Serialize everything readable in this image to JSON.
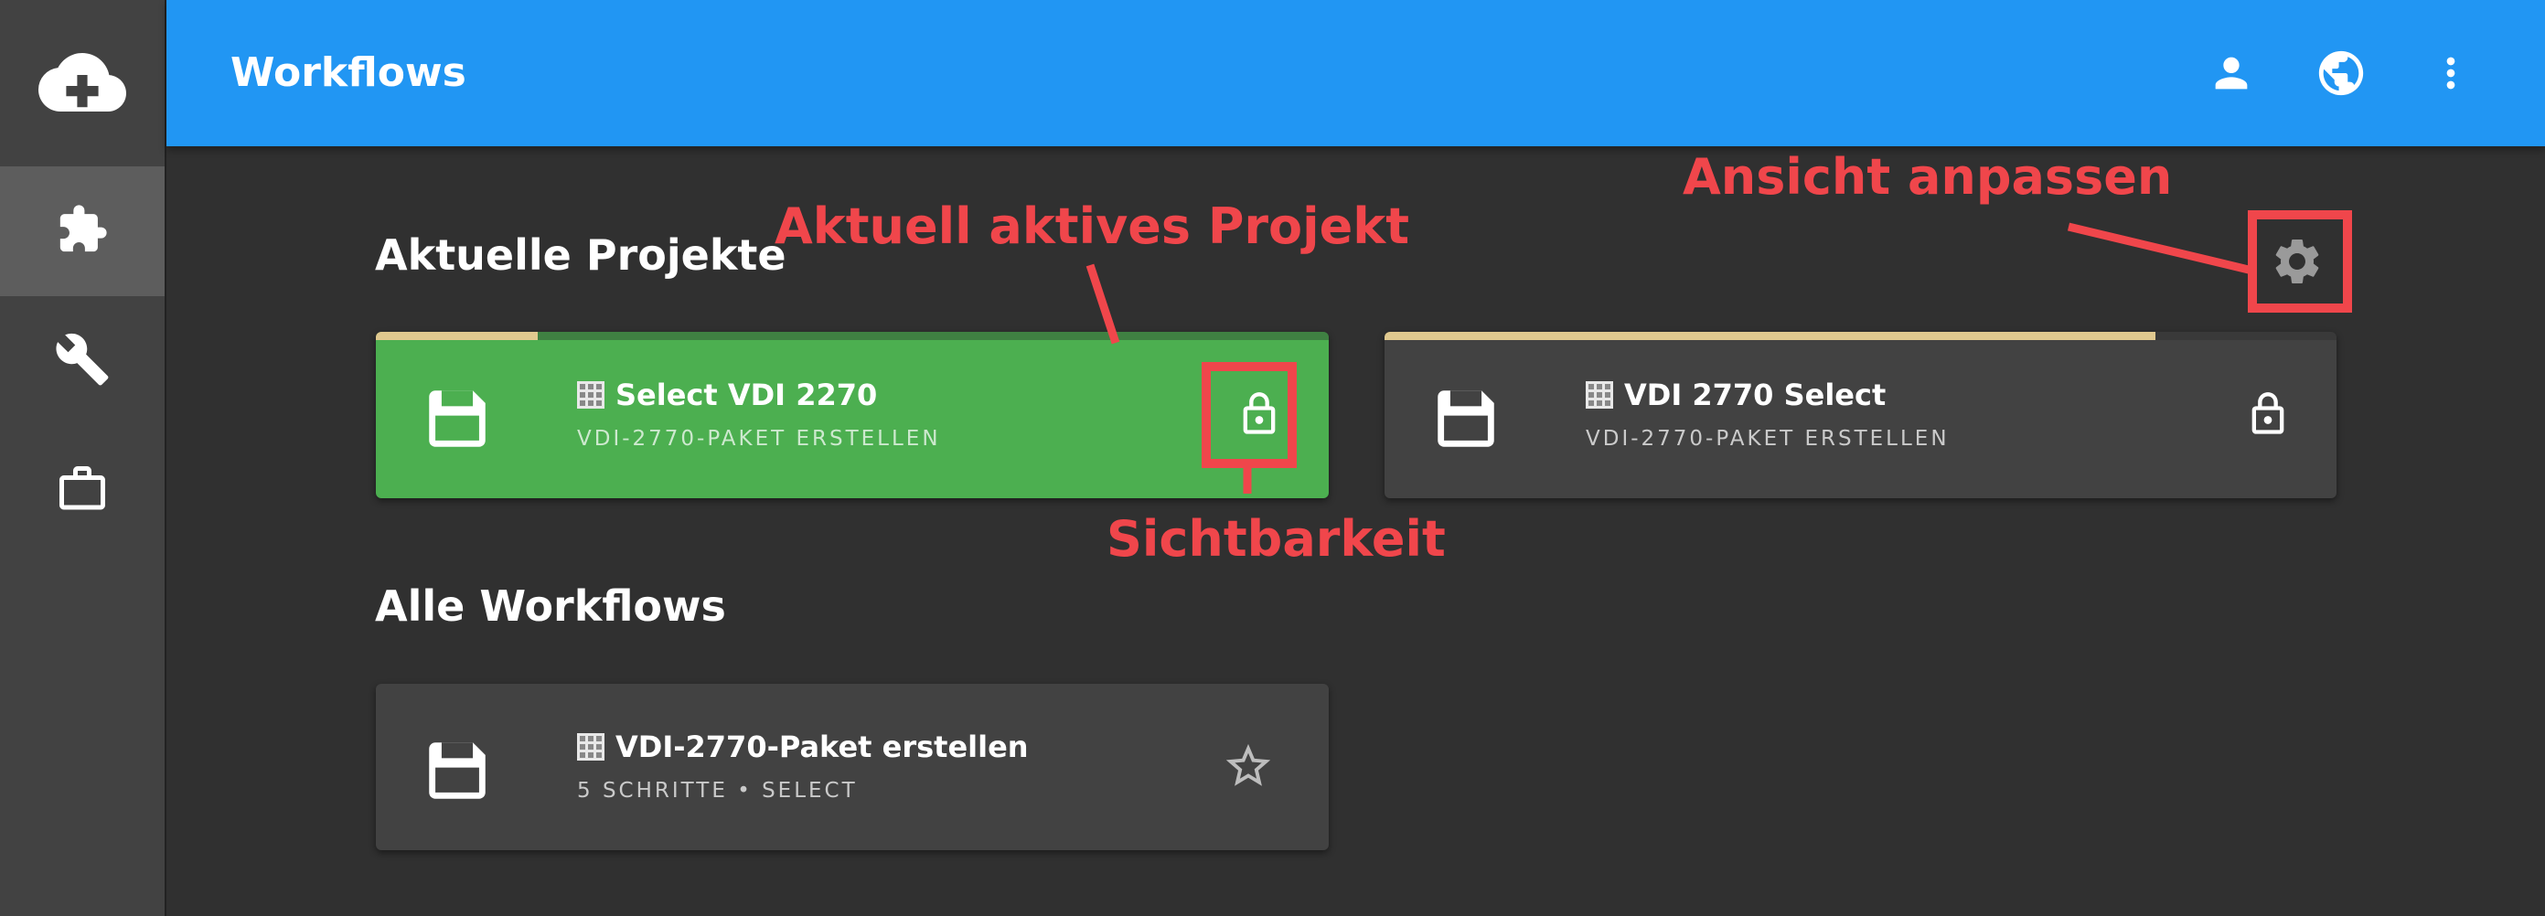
{
  "header": {
    "title": "Workflows",
    "icons": [
      "person-icon",
      "globe-icon",
      "more-vert-icon"
    ]
  },
  "sidebar": {
    "logo": "cloud-upload-icon",
    "items": [
      {
        "icon": "puzzle-icon",
        "active": true
      },
      {
        "icon": "wrench-icon",
        "active": false
      },
      {
        "icon": "briefcase-icon",
        "active": false
      }
    ]
  },
  "sections": {
    "current_projects": "Aktuelle Projekte",
    "all_workflows": "Alle Workflows"
  },
  "current_projects": [
    {
      "title": "Select VDI 2270",
      "subtitle": "VDI-2770-PAKET ERSTELLEN",
      "progress": 0.17,
      "active": true,
      "action_icon": "lock-open-icon",
      "color": "#4caf50"
    },
    {
      "title": "VDI 2770 Select",
      "subtitle": "VDI-2770-PAKET ERSTELLEN",
      "progress": 0.81,
      "active": false,
      "action_icon": "lock-open-icon",
      "color": "#424242"
    }
  ],
  "workflows": [
    {
      "title": "VDI-2770-Paket erstellen",
      "subtitle": "5 SCHRITTE • SELECT",
      "action_icon": "star-outline-icon"
    }
  ],
  "annotations": {
    "active_project": "Aktuell aktives Projekt",
    "visibility": "Sichtbarkeit",
    "customize_view": "Ansicht anpassen"
  },
  "colors": {
    "topbar": "#2196f3",
    "accent_green": "#4caf50",
    "annotation_red": "#f0464b",
    "progress_fill": "#e0c98f"
  }
}
